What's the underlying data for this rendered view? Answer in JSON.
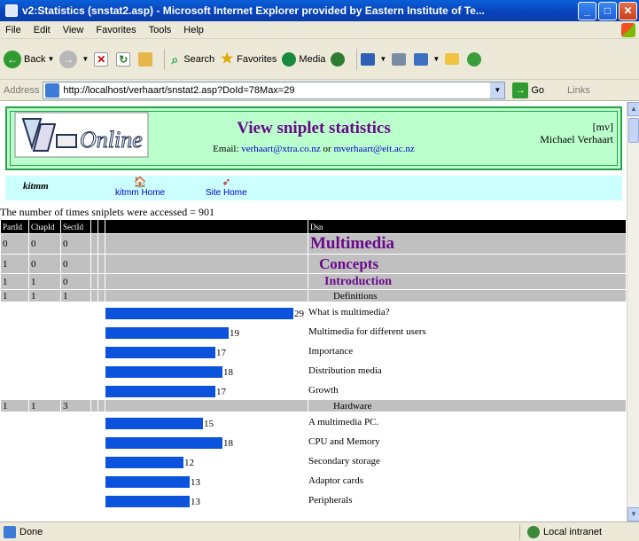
{
  "window": {
    "title": "v2:Statistics (snstat2.asp) - Microsoft Internet Explorer provided by Eastern Institute of Te..."
  },
  "menu": [
    "File",
    "Edit",
    "View",
    "Favorites",
    "Tools",
    "Help"
  ],
  "toolbar": {
    "back": "Back",
    "search": "Search",
    "favorites": "Favorites",
    "media": "Media"
  },
  "address": {
    "label": "Address",
    "url": "http://localhost/verhaart/snstat2.asp?DoId=78Max=29",
    "go": "Go",
    "links": "Links"
  },
  "page": {
    "logo_text": "Online",
    "title": "View sniplet statistics",
    "email_prefix": "Email:",
    "email1": "verhaart@xtra.co.nz",
    "email_or": "or",
    "email2": "mverhaart@eit.ac.nz",
    "author_tag": "[mv]",
    "author_name": "Michael Verhaart",
    "nav_label": "kitmm",
    "nav_home": "kitmm Home",
    "nav_site": "Site Home",
    "count_text": "The number of times sniplets were accessed = 901"
  },
  "table": {
    "headers": [
      "PartId",
      "ChapId",
      "SectId",
      "",
      "",
      "",
      "Dsn"
    ],
    "max": 29,
    "rows": [
      {
        "kind": "level",
        "level": 0,
        "part": "0",
        "chap": "0",
        "sect": "0",
        "title": "Multimedia"
      },
      {
        "kind": "level",
        "level": 1,
        "part": "1",
        "chap": "0",
        "sect": "0",
        "title": "Concepts"
      },
      {
        "kind": "level",
        "level": 2,
        "part": "1",
        "chap": "1",
        "sect": "0",
        "title": "Introduction"
      },
      {
        "kind": "level",
        "level": 3,
        "part": "1",
        "chap": "1",
        "sect": "1",
        "title": "Definitions"
      },
      {
        "kind": "item",
        "value": 29,
        "title": "What is multimedia?"
      },
      {
        "kind": "item",
        "value": 19,
        "title": "Multimedia for different users"
      },
      {
        "kind": "item",
        "value": 17,
        "title": "Importance"
      },
      {
        "kind": "item",
        "value": 18,
        "title": "Distribution media"
      },
      {
        "kind": "item",
        "value": 17,
        "title": "Growth"
      },
      {
        "kind": "level",
        "level": 3,
        "part": "1",
        "chap": "1",
        "sect": "3",
        "title": "Hardware"
      },
      {
        "kind": "item",
        "value": 15,
        "title": "A multimedia PC."
      },
      {
        "kind": "item",
        "value": 18,
        "title": "CPU and Memory"
      },
      {
        "kind": "item",
        "value": 12,
        "title": "Secondary storage"
      },
      {
        "kind": "item",
        "value": 13,
        "title": "Adaptor cards"
      },
      {
        "kind": "item",
        "value": 13,
        "title": "Peripherals"
      }
    ]
  },
  "status": {
    "text": "Done",
    "zone": "Local intranet"
  },
  "colors": {
    "bar": "#0b53dd",
    "header_bg": "#bbffcc",
    "nav_bg": "#ccffff",
    "title_purple": "#6a0a8a"
  }
}
